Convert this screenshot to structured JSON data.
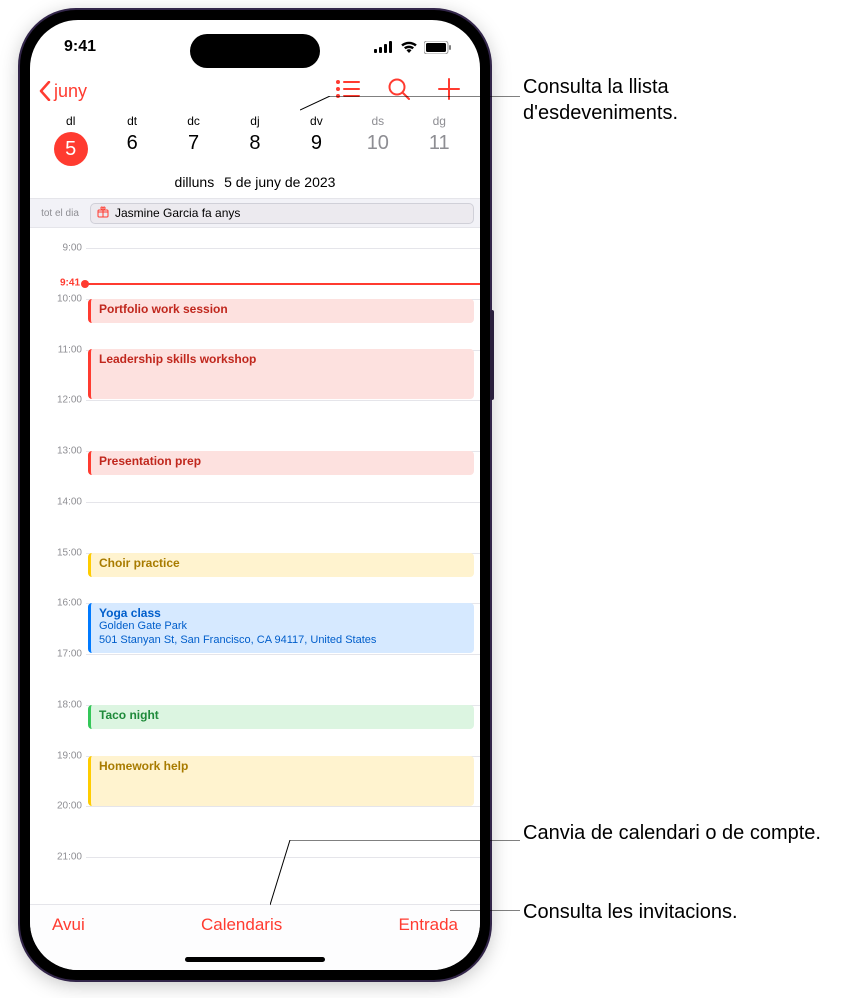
{
  "statusbar": {
    "time": "9:41"
  },
  "nav": {
    "back_label": "juny"
  },
  "week": {
    "day_headers": [
      "dl",
      "dt",
      "dc",
      "dj",
      "dv",
      "ds",
      "dg"
    ],
    "day_numbers": [
      "5",
      "6",
      "7",
      "8",
      "9",
      "10",
      "11"
    ],
    "full_date_dow": "dilluns",
    "full_date": "5 de juny de 2023"
  },
  "allday": {
    "label": "tot el dia",
    "event_title": "Jasmine Garcia fa anys"
  },
  "hours": [
    "9:00",
    "10:00",
    "11:00",
    "12:00",
    "13:00",
    "14:00",
    "15:00",
    "16:00",
    "17:00",
    "18:00",
    "19:00",
    "20:00",
    "21:00"
  ],
  "now_label": "9:41",
  "events": {
    "portfolio": "Portfolio work session",
    "leadership": "Leadership skills workshop",
    "presentation": "Presentation prep",
    "choir": "Choir practice",
    "yoga_title": "Yoga class",
    "yoga_loc1": "Golden Gate Park",
    "yoga_loc2": "501 Stanyan St, San Francisco, CA 94117, United States",
    "taco": "Taco night",
    "homework": "Homework help"
  },
  "toolbar": {
    "today": "Avui",
    "calendars": "Calendaris",
    "inbox": "Entrada"
  },
  "callouts": {
    "list": "Consulta la llista d'esdeveniments.",
    "switch": "Canvia de calendari o de compte.",
    "invites": "Consulta les invitacions."
  }
}
